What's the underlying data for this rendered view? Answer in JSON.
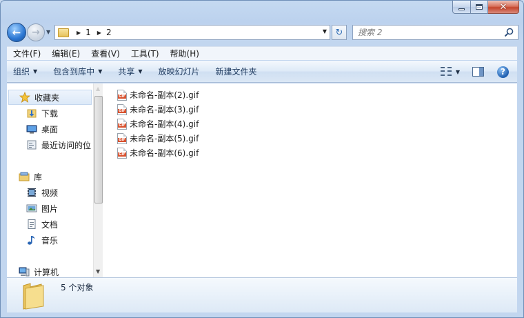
{
  "nav": {
    "breadcrumb": [
      "1",
      "2"
    ],
    "search_placeholder": "搜索 2"
  },
  "menubar": {
    "items": [
      "文件(F)",
      "编辑(E)",
      "查看(V)",
      "工具(T)",
      "帮助(H)"
    ]
  },
  "commandbar": {
    "organize": "组织",
    "include_in_library": "包含到库中",
    "share": "共享",
    "slideshow": "放映幻灯片",
    "new_folder": "新建文件夹"
  },
  "sidebar": {
    "favorites": "收藏夹",
    "downloads": "下载",
    "desktop": "桌面",
    "recent": "最近访问的位",
    "libraries": "库",
    "videos": "视频",
    "pictures": "图片",
    "documents": "文档",
    "music": "音乐",
    "computer": "计算机"
  },
  "files": [
    "未命名-副本(2).gif",
    "未命名-副本(3).gif",
    "未命名-副本(4).gif",
    "未命名-副本(5).gif",
    "未命名-副本(6).gif"
  ],
  "file_icon_label": "GIF",
  "status": {
    "item_count": "5 个对象"
  }
}
